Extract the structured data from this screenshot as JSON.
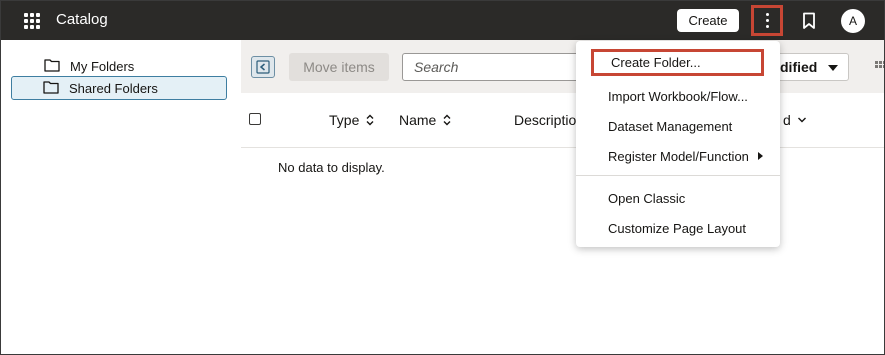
{
  "header": {
    "title": "Catalog",
    "create_label": "Create",
    "avatar_initial": "A",
    "icons": [
      "apps-grid-icon",
      "kebab-menu-icon",
      "bookmark-icon"
    ]
  },
  "sidebar": {
    "items": [
      {
        "label": "My Folders",
        "icon": "folder-icon",
        "selected": false
      },
      {
        "label": "Shared Folders",
        "icon": "folder-icon",
        "selected": true
      }
    ]
  },
  "toolbar": {
    "move_items_label": "Move items",
    "search_placeholder": "Search",
    "sort_label": "dified"
  },
  "table": {
    "columns": [
      "Type",
      "Name",
      "Description",
      "d"
    ],
    "empty_text": "No data to display."
  },
  "menu": {
    "items": [
      {
        "label": "Create Folder...",
        "highlighted": true
      },
      {
        "label": "Import Workbook/Flow..."
      },
      {
        "label": "Dataset Management"
      },
      {
        "label": "Register Model/Function",
        "has_submenu": true
      },
      {
        "label": "Open Classic"
      },
      {
        "label": "Customize Page Layout"
      }
    ]
  },
  "colors": {
    "header_bg": "#2b2a28",
    "highlight_border": "#c74634",
    "selected_bg": "#e4f0f6",
    "selected_border": "#3e7ea1",
    "toolbar_bg": "#f1efed"
  }
}
